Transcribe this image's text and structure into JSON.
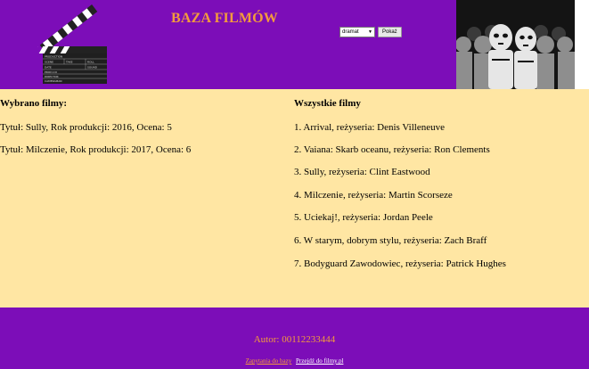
{
  "header": {
    "title": "BAZA FILMÓW",
    "select": {
      "selected": "dramat"
    },
    "submit_label": "Pokaż",
    "clapper_text": [
      "PRODUCTION",
      "SCENE",
      "TAKE",
      "ROLL",
      "DATE",
      "SOUND",
      "PROD.CO",
      "DIRECTOR",
      "CAMERAMAN"
    ]
  },
  "left": {
    "heading": "Wybrano filmy:",
    "items": [
      "Tytuł: Sully, Rok produkcji: 2016, Ocena: 5",
      "Tytuł: Milczenie, Rok produkcji: 2017, Ocena: 6"
    ]
  },
  "right": {
    "heading": "Wszystkie filmy",
    "items": [
      "1. Arrival, reżyseria: Denis Villeneuve",
      "2. Vaiana: Skarb oceanu, reżyseria: Ron Clements",
      "3. Sully, reżyseria: Clint Eastwood",
      "4. Milczenie, reżyseria: Martin Scorseze",
      "5. Uciekaj!, reżyseria: Jordan Peele",
      "6. W starym, dobrym stylu, reżyseria: Zach Braff",
      "7. Bodyguard Zawodowiec, reżyseria: Patrick Hughes"
    ]
  },
  "footer": {
    "author": "Autor: 00112233444",
    "link1": "Zapytania do bazy",
    "link2": "Przejdź do filmy.pl"
  },
  "colors": {
    "purple": "#7c0db8",
    "orange": "#f39b3c",
    "cream": "#ffe6a3"
  },
  "icons": {
    "clapper": "clapperboard-image",
    "photo": "stormtroopers-photo"
  }
}
